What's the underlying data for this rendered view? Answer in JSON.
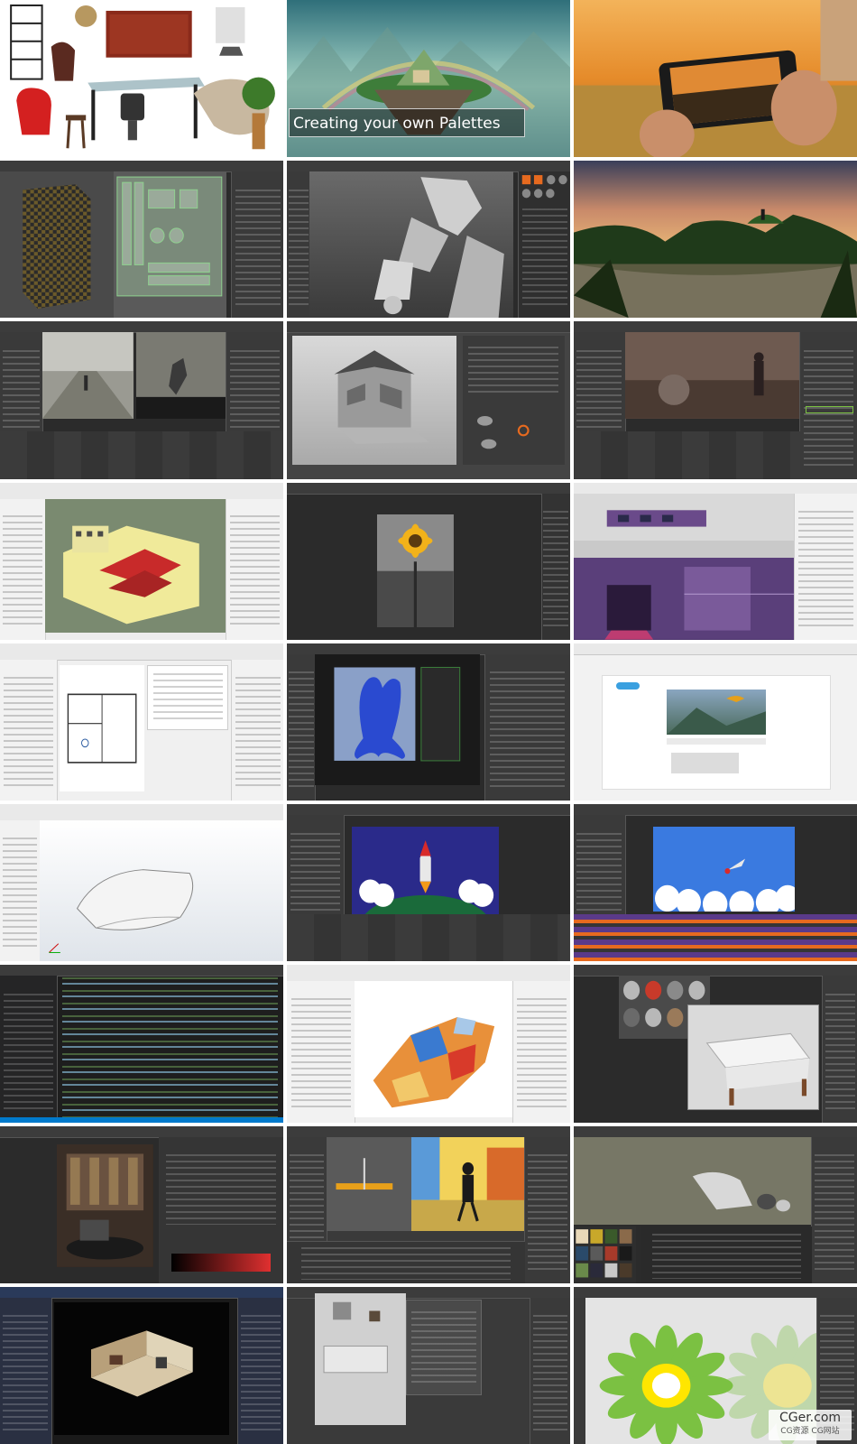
{
  "collage": {
    "tile_1_1": {
      "scene": "furniture product collage",
      "icon": "furniture-collage-image"
    },
    "tile_1_2": {
      "scene": "floating island fantasy landscape",
      "caption": "Creating your own Palettes"
    },
    "tile_1_3": {
      "scene": "phone photographing sunset field",
      "icon": "smartphone-photo-image"
    },
    "tile_2_1": {
      "scene": "3d uv unwrap editor",
      "icon": "uv-editor-screenshot"
    },
    "tile_2_2": {
      "scene": "robot sculpting software",
      "icon": "robot-sculpt-screenshot"
    },
    "tile_2_3": {
      "scene": "sunset lake landscape render",
      "icon": "landscape-render-image"
    },
    "tile_3_1": {
      "scene": "video editing compositing",
      "icon": "video-editor-screenshot"
    },
    "tile_3_2": {
      "scene": "house model in 3d viewport",
      "icon": "house-model-screenshot"
    },
    "tile_3_3": {
      "scene": "compositing node editor",
      "icon": "compositing-screenshot"
    },
    "tile_4_1": {
      "scene": "bim architecture model",
      "icon": "bim-model-screenshot"
    },
    "tile_4_2": {
      "scene": "photo editing sunflower",
      "icon": "sunflower-photo-screenshot"
    },
    "tile_4_3": {
      "scene": "pixel art game editor",
      "icon": "game-editor-screenshot"
    },
    "tile_5_1": {
      "scene": "floor plan schedule",
      "icon": "floor-plan-screenshot"
    },
    "tile_5_2": {
      "scene": "blue character sculpt",
      "icon": "character-sculpt-screenshot"
    },
    "tile_5_3": {
      "scene": "web video player page",
      "icon": "video-player-screenshot"
    },
    "tile_6_1": {
      "scene": "cad solid modeling",
      "icon": "cad-model-screenshot"
    },
    "tile_6_2": {
      "scene": "rocket animation",
      "icon": "rocket-animation-screenshot"
    },
    "tile_6_3": {
      "scene": "motion graphics timeline",
      "icon": "motion-graphics-screenshot"
    },
    "tile_7_1": {
      "scene": "code editor",
      "icon": "code-editor-screenshot"
    },
    "tile_7_2": {
      "scene": "gis land use map",
      "icon": "gis-map-screenshot"
    },
    "tile_7_3": {
      "scene": "material library table scene",
      "icon": "material-editor-screenshot"
    },
    "tile_8_1": {
      "scene": "interior render",
      "icon": "interior-render-screenshot"
    },
    "tile_8_2": {
      "scene": "game character in engine",
      "icon": "game-engine-screenshot"
    },
    "tile_8_3": {
      "scene": "animation robot scene",
      "icon": "animation-scene-screenshot"
    },
    "tile_9_1": {
      "scene": "room model render",
      "icon": "room-render-screenshot"
    },
    "tile_9_2": {
      "scene": "interior top view editor",
      "icon": "interior-editor-screenshot"
    },
    "tile_9_3": {
      "scene": "logo vector design",
      "icon": "logo-design-screenshot"
    }
  },
  "watermark": {
    "main": "CGer.com",
    "sub": "CG资源 CG网站"
  },
  "colors": {
    "app_dark": "#2b2b2b",
    "panel": "#3a3a3a",
    "accent_orange": "#e66a1f",
    "logo_green": "#7bc142",
    "logo_yellow": "#ffe600"
  }
}
